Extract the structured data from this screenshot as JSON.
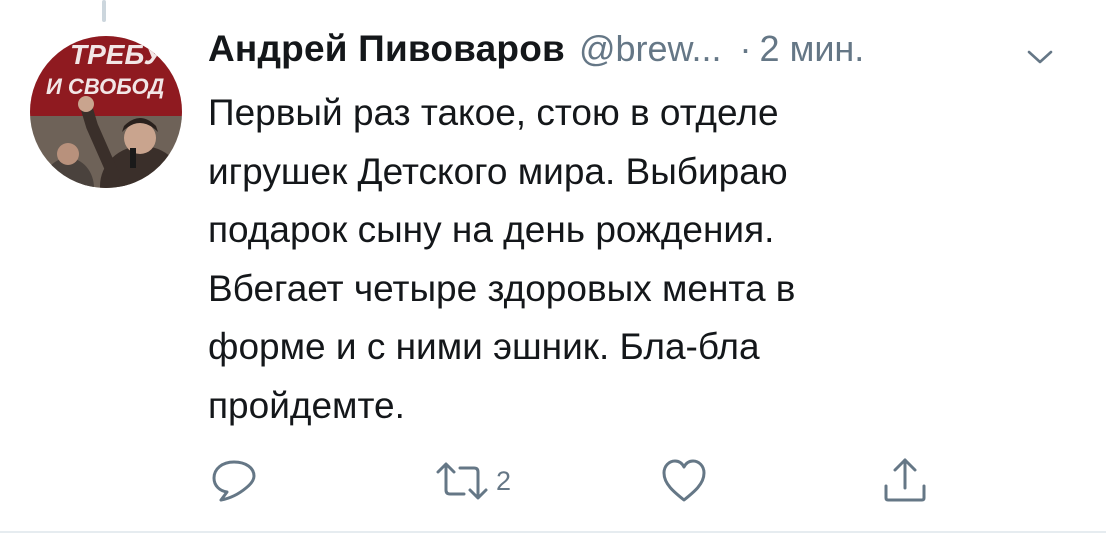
{
  "tweet": {
    "author_name": "Андрей Пивоваров",
    "handle": "@brew...",
    "separator": "·",
    "time": "2 мин.",
    "text_lines": [
      "Первый раз такое, стою в отделе",
      "игрушек Детского мира. Выбираю",
      "подарок сыну на день рождения.",
      "Вбегает четыре здоровых мента в",
      "форме и с ними эшник. Бла-бла",
      "пройдемте."
    ]
  },
  "avatar": {
    "banner_line1": "ТРЕБУ",
    "banner_line2": "И СВОБОД",
    "banner_color": "#9b1c23"
  },
  "actions": {
    "reply_icon": "reply-icon",
    "retweet_icon": "retweet-icon",
    "retweet_count": "2",
    "like_icon": "heart-icon",
    "share_icon": "share-icon"
  },
  "colors": {
    "text": "#14171a",
    "secondary": "#657786",
    "border": "#e6ecf0"
  }
}
